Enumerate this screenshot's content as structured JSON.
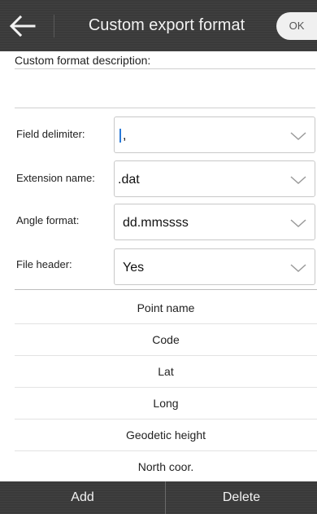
{
  "header": {
    "title": "Custom export format",
    "ok_label": "OK",
    "back_icon": "arrow-left-icon"
  },
  "form": {
    "description_label": "Custom format description:",
    "description_value": "",
    "field_delimiter": {
      "label": "Field delimiter:",
      "value": ","
    },
    "extension_name": {
      "label": "Extension name:",
      "value": ".dat"
    },
    "angle_format": {
      "label": "Angle format:",
      "value": "dd.mmssss"
    },
    "file_header": {
      "label": "File header:",
      "value": "Yes"
    }
  },
  "fields_list": [
    "Point name",
    "Code",
    "Lat",
    "Long",
    "Geodetic height",
    "North coor."
  ],
  "bottom_bar": {
    "add_label": "Add",
    "delete_label": "Delete"
  }
}
